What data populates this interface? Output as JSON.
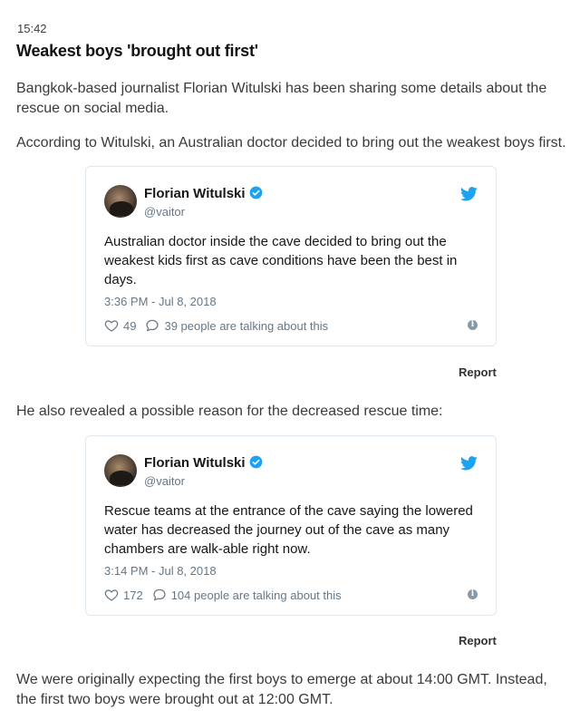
{
  "article": {
    "time": "15:42",
    "headline": "Weakest boys 'brought out first'",
    "paragraphs": [
      "Bangkok-based journalist Florian Witulski has been sharing some details about the rescue on social media.",
      "According to Witulski, an Australian doctor decided to bring out the weakest boys first.",
      "He also revealed a possible reason for the decreased rescue time:",
      "We were originally expecting the first boys to emerge at about 14:00 GMT. Instead, the first two boys were brought out at 12:00 GMT."
    ]
  },
  "tweets": [
    {
      "author": "Florian Witulski",
      "handle": "@vaitor",
      "text": "Australian doctor inside the cave decided to bring out the weakest kids first as cave conditions have been the best in days.",
      "date": "3:36 PM - Jul 8, 2018",
      "likes": "49",
      "talking": "39 people are talking about this",
      "report_label": "Report"
    },
    {
      "author": "Florian Witulski",
      "handle": "@vaitor",
      "text": "Rescue teams at the entrance of the cave saying the lowered water has decreased the journey out of the cave as many chambers are walk-able right now.",
      "date": "3:14 PM - Jul 8, 2018",
      "likes": "172",
      "talking": "104 people are talking about this",
      "report_label": "Report"
    }
  ],
  "icons": {
    "verified": "verified-badge-icon",
    "twitter": "twitter-bird-icon",
    "like": "heart-icon",
    "reply": "speech-bubble-icon",
    "info": "info-icon"
  },
  "colors": {
    "twitter_blue": "#1da1f2",
    "meta_grey": "#657786",
    "border": "#e1e8ed"
  }
}
